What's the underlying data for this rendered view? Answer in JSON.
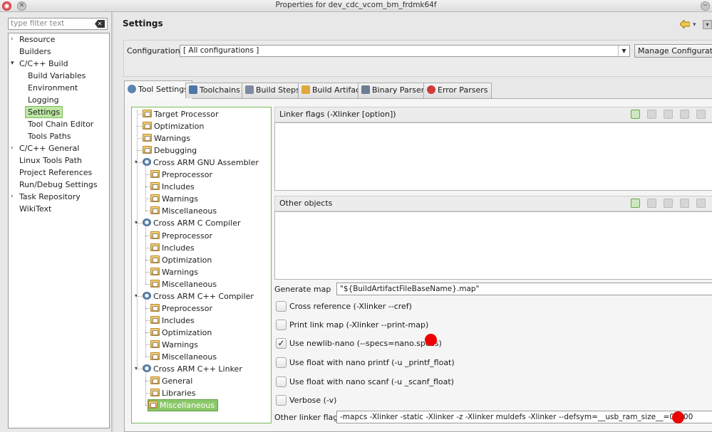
{
  "window": {
    "title": "Properties for dev_cdc_vcom_bm_frdmk64f"
  },
  "filter": {
    "placeholder": "type filter text"
  },
  "nav": {
    "items": [
      {
        "label": "Resource",
        "expandable": true,
        "level": 0
      },
      {
        "label": "Builders",
        "expandable": false,
        "level": 0
      },
      {
        "label": "C/C++ Build",
        "expandable": true,
        "expanded": true,
        "level": 0
      },
      {
        "label": "Build Variables",
        "level": 1
      },
      {
        "label": "Environment",
        "level": 1
      },
      {
        "label": "Logging",
        "level": 1
      },
      {
        "label": "Settings",
        "level": 1,
        "selected": true
      },
      {
        "label": "Tool Chain Editor",
        "level": 1
      },
      {
        "label": "Tools Paths",
        "level": 1
      },
      {
        "label": "C/C++ General",
        "expandable": true,
        "level": 0
      },
      {
        "label": "Linux Tools Path",
        "level": 0
      },
      {
        "label": "Project References",
        "level": 0
      },
      {
        "label": "Run/Debug Settings",
        "level": 0
      },
      {
        "label": "Task Repository",
        "expandable": true,
        "level": 0
      },
      {
        "label": "WikiText",
        "level": 0
      }
    ]
  },
  "header": {
    "title": "Settings"
  },
  "configuration": {
    "label": "Configuration:",
    "value": "[ All configurations ]",
    "manage_label": "Manage Configurations..."
  },
  "tabs": [
    {
      "label": "Tool Settings",
      "active": true,
      "icon": "gear-icon"
    },
    {
      "label": "Toolchains",
      "icon": "toolchain-icon"
    },
    {
      "label": "Build Steps",
      "icon": "wrench-icon"
    },
    {
      "label": "Build Artifact",
      "icon": "artifact-icon"
    },
    {
      "label": "Binary Parsers",
      "icon": "binary-icon"
    },
    {
      "label": "Error Parsers",
      "icon": "error-icon"
    }
  ],
  "tool_tree": {
    "items": [
      {
        "label": "Target Processor",
        "icon": "folder-options-icon",
        "level": 0
      },
      {
        "label": "Optimization",
        "icon": "folder-options-icon",
        "level": 0
      },
      {
        "label": "Warnings",
        "icon": "folder-options-icon",
        "level": 0
      },
      {
        "label": "Debugging",
        "icon": "folder-options-icon",
        "level": 0
      },
      {
        "label": "Cross ARM GNU Assembler",
        "icon": "tool-gear-icon",
        "level": 0,
        "expanded": true
      },
      {
        "label": "Preprocessor",
        "icon": "folder-options-icon",
        "level": 1
      },
      {
        "label": "Includes",
        "icon": "folder-options-icon",
        "level": 1
      },
      {
        "label": "Warnings",
        "icon": "folder-options-icon",
        "level": 1
      },
      {
        "label": "Miscellaneous",
        "icon": "folder-options-icon",
        "level": 1
      },
      {
        "label": "Cross ARM C Compiler",
        "icon": "tool-gear-icon",
        "level": 0,
        "expanded": true
      },
      {
        "label": "Preprocessor",
        "icon": "folder-options-icon",
        "level": 1
      },
      {
        "label": "Includes",
        "icon": "folder-options-icon",
        "level": 1
      },
      {
        "label": "Optimization",
        "icon": "folder-options-icon",
        "level": 1
      },
      {
        "label": "Warnings",
        "icon": "folder-options-icon",
        "level": 1
      },
      {
        "label": "Miscellaneous",
        "icon": "folder-options-icon",
        "level": 1
      },
      {
        "label": "Cross ARM C++ Compiler",
        "icon": "tool-gear-icon",
        "level": 0,
        "expanded": true
      },
      {
        "label": "Preprocessor",
        "icon": "folder-options-icon",
        "level": 1
      },
      {
        "label": "Includes",
        "icon": "folder-options-icon",
        "level": 1
      },
      {
        "label": "Optimization",
        "icon": "folder-options-icon",
        "level": 1
      },
      {
        "label": "Warnings",
        "icon": "folder-options-icon",
        "level": 1
      },
      {
        "label": "Miscellaneous",
        "icon": "folder-options-icon",
        "level": 1
      },
      {
        "label": "Cross ARM C++ Linker",
        "icon": "tool-gear-icon",
        "level": 0,
        "expanded": true
      },
      {
        "label": "General",
        "icon": "folder-options-icon",
        "level": 1
      },
      {
        "label": "Libraries",
        "icon": "folder-options-icon",
        "level": 1
      },
      {
        "label": "Miscellaneous",
        "icon": "folder-options-icon",
        "level": 1,
        "selected": true
      }
    ]
  },
  "linker_flags": {
    "title": "Linker flags (-Xlinker [option])"
  },
  "other_objects": {
    "title": "Other objects"
  },
  "generate_map": {
    "label": "Generate map",
    "value": "\"${BuildArtifactFileBaseName}.map\""
  },
  "checkboxes": [
    {
      "label": "Cross reference (-Xlinker --cref)",
      "checked": false
    },
    {
      "label": "Print link map (-Xlinker --print-map)",
      "checked": false
    },
    {
      "label": "Use newlib-nano (--specs=nano.specs)",
      "checked": true,
      "marked": true
    },
    {
      "label": "Use float with nano printf (-u _printf_float)",
      "checked": false
    },
    {
      "label": "Use float with nano scanf (-u _scanf_float)",
      "checked": false
    },
    {
      "label": "Verbose (-v)",
      "checked": false
    }
  ],
  "other_linker_flags": {
    "label": "Other linker flags",
    "value": "-mapcs  -Xlinker -static  -Xlinker -z  -Xlinker muldefs  -Xlinker --defsym=__usb_ram_size__=0x800"
  },
  "colors": {
    "selection_green": "#8bc86a",
    "marker_red": "#ee0000"
  }
}
